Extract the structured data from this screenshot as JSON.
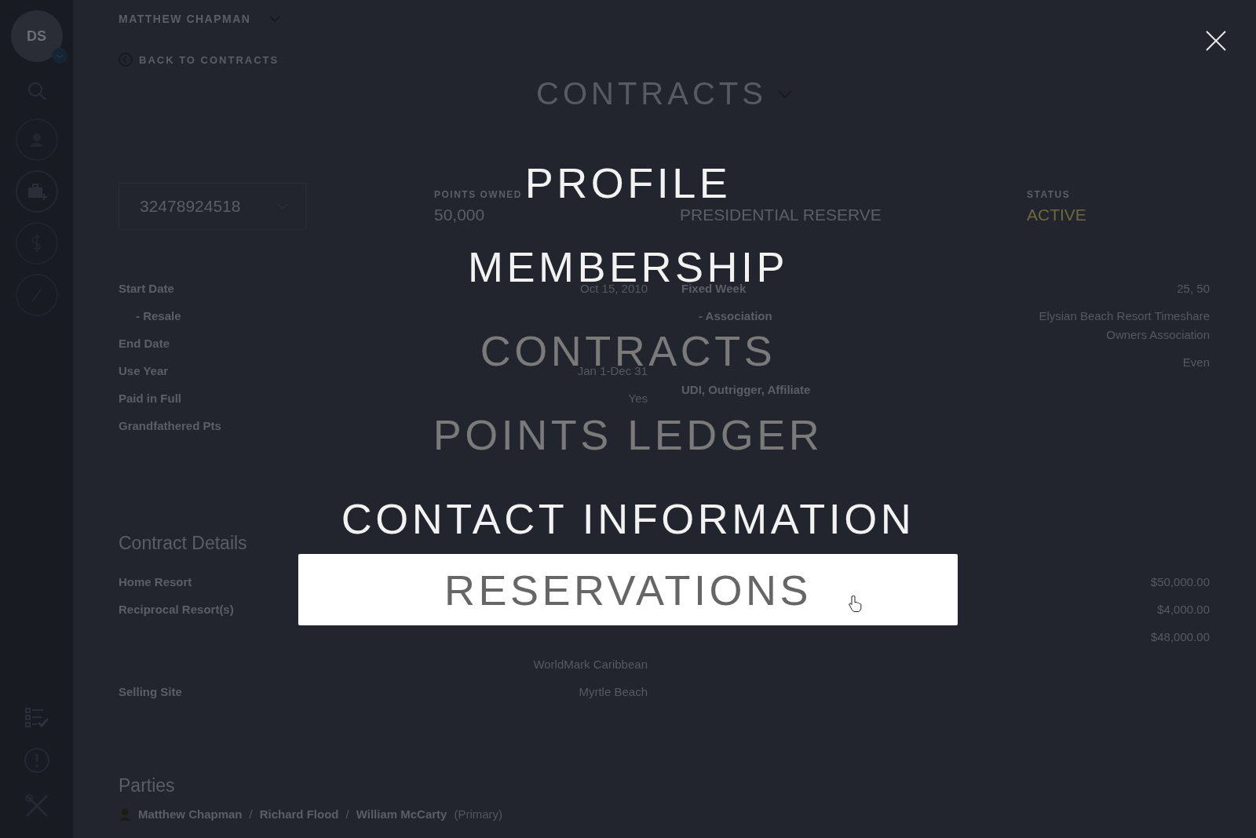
{
  "sidebar": {
    "avatar": "DS"
  },
  "header": {
    "member_name": "MATTHEW CHAPMAN",
    "back_link": "BACK TO CONTRACTS",
    "page_title": "CONTRACTS"
  },
  "contract": {
    "number": "32478924518",
    "stats": [
      {
        "kind": "plain",
        "label": "POINTS OWNED",
        "value": "50,000"
      },
      {
        "kind": "plain",
        "value": "PRESIDENTIAL RESERVE"
      },
      {
        "kind": "status",
        "label": "STATUS",
        "value": "ACTIVE"
      }
    ]
  },
  "details_left": [
    {
      "label": "Start Date",
      "value": "Oct 15, 2010"
    },
    {
      "label": "- Resale",
      "kind": "sub"
    },
    {
      "label": "End Date"
    },
    {
      "label": "Use Year",
      "value": "Jan 1-Dec 31"
    },
    {
      "label": "Paid in Full",
      "value": "Yes"
    },
    {
      "label": "Grandfathered Pts"
    }
  ],
  "details_right": [
    {
      "label": "Fixed Week",
      "value": "25, 50"
    },
    {
      "label": "- Association",
      "kind": "sub",
      "value": "Elysian Beach Resort Timeshare Owners Association"
    },
    {
      "value": "Even"
    },
    {
      "label": "UDI, Outrigger, Affiliate"
    }
  ],
  "contract_details": {
    "heading": "Contract Details",
    "left": [
      {
        "label": "Home Resort"
      },
      {
        "label": "Reciprocal Resort(s)"
      },
      {
        "value": "WorldMark Caribbean"
      },
      {
        "label": "Selling Site",
        "value": "Myrtle Beach"
      }
    ],
    "right": [
      {
        "value": "$50,000.00"
      },
      {
        "value": "$4,000.00"
      },
      {
        "value": "$48,000.00"
      }
    ]
  },
  "parties": {
    "heading": "Parties",
    "separator": "/",
    "people": [
      {
        "name": "Matthew Chapman"
      },
      {
        "name": "Richard Flood"
      },
      {
        "name": "William McCarty",
        "note": "(Primary)"
      }
    ]
  },
  "menu": [
    {
      "label": "PROFILE",
      "disabled": false,
      "hovered": false
    },
    {
      "label": "MEMBERSHIP",
      "disabled": false,
      "hovered": false
    },
    {
      "label": "CONTRACTS",
      "disabled": true,
      "hovered": false
    },
    {
      "label": "POINTS LEDGER",
      "disabled": true,
      "hovered": false
    },
    {
      "label": "CONTACT INFORMATION",
      "disabled": false,
      "hovered": false
    },
    {
      "label": "RESERVATIONS",
      "disabled": false,
      "hovered": true
    }
  ]
}
